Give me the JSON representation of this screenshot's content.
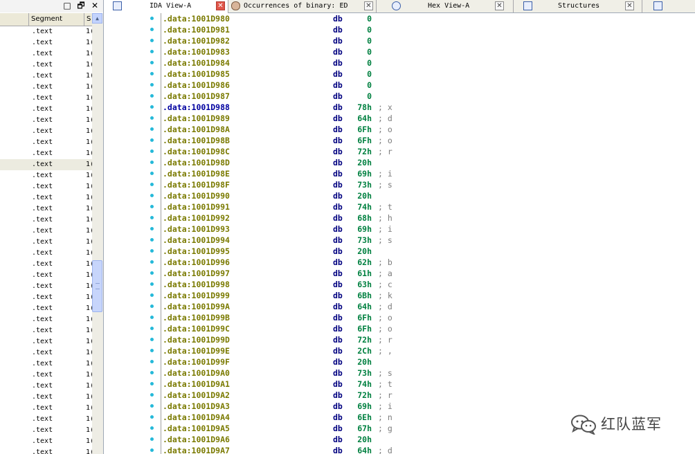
{
  "left_pane": {
    "header": {
      "segment": "Segment",
      "s": "S"
    },
    "title_buttons": [
      "□",
      "🗗",
      "✕"
    ],
    "rows": [
      {
        "segment": ".text",
        "s": "1("
      },
      {
        "segment": ".text",
        "s": "1("
      },
      {
        "segment": ".text",
        "s": "1("
      },
      {
        "segment": ".text",
        "s": "1("
      },
      {
        "segment": ".text",
        "s": "1("
      },
      {
        "segment": ".text",
        "s": "1("
      },
      {
        "segment": ".text",
        "s": "1("
      },
      {
        "segment": ".text",
        "s": "1("
      },
      {
        "segment": ".text",
        "s": "1("
      },
      {
        "segment": ".text",
        "s": "1("
      },
      {
        "segment": ".text",
        "s": "1("
      },
      {
        "segment": ".text",
        "s": "1("
      },
      {
        "segment": ".text",
        "s": "1("
      },
      {
        "segment": ".text",
        "s": "1("
      },
      {
        "segment": ".text",
        "s": "1("
      },
      {
        "segment": ".text",
        "s": "1("
      },
      {
        "segment": ".text",
        "s": "1("
      },
      {
        "segment": ".text",
        "s": "1("
      },
      {
        "segment": ".text",
        "s": "1("
      },
      {
        "segment": ".text",
        "s": "1("
      },
      {
        "segment": ".text",
        "s": "1("
      },
      {
        "segment": ".text",
        "s": "1("
      },
      {
        "segment": ".text",
        "s": "1("
      },
      {
        "segment": ".text",
        "s": "1("
      },
      {
        "segment": ".text",
        "s": "1("
      },
      {
        "segment": ".text",
        "s": "1("
      },
      {
        "segment": ".text",
        "s": "1("
      },
      {
        "segment": ".text",
        "s": "1("
      },
      {
        "segment": ".text",
        "s": "1("
      },
      {
        "segment": ".text",
        "s": "1("
      },
      {
        "segment": ".text",
        "s": "1("
      },
      {
        "segment": ".text",
        "s": "1("
      },
      {
        "segment": ".text",
        "s": "1("
      },
      {
        "segment": ".text",
        "s": "1("
      },
      {
        "segment": ".text",
        "s": "1("
      },
      {
        "segment": ".text",
        "s": "1("
      },
      {
        "segment": ".text",
        "s": "1("
      },
      {
        "segment": ".text",
        "s": "1("
      },
      {
        "segment": ".text",
        "s": "1("
      },
      {
        "segment": ".text",
        "s": "1("
      }
    ],
    "selected_row": 12
  },
  "tabs": [
    {
      "label": "IDA View-A",
      "close": "✕"
    },
    {
      "label": "Occurrences of binary: ED",
      "close": "✕"
    },
    {
      "label": "Hex View-A",
      "close": "✕"
    },
    {
      "label": "Structures",
      "close": "✕"
    }
  ],
  "disasm": {
    "rows": [
      {
        "addr": ".data:1001D980",
        "mn": "db",
        "val": "0",
        "cmt": ""
      },
      {
        "addr": ".data:1001D981",
        "mn": "db",
        "val": "0",
        "cmt": ""
      },
      {
        "addr": ".data:1001D982",
        "mn": "db",
        "val": "0",
        "cmt": ""
      },
      {
        "addr": ".data:1001D983",
        "mn": "db",
        "val": "0",
        "cmt": ""
      },
      {
        "addr": ".data:1001D984",
        "mn": "db",
        "val": "0",
        "cmt": ""
      },
      {
        "addr": ".data:1001D985",
        "mn": "db",
        "val": "0",
        "cmt": ""
      },
      {
        "addr": ".data:1001D986",
        "mn": "db",
        "val": "0",
        "cmt": ""
      },
      {
        "addr": ".data:1001D987",
        "mn": "db",
        "val": "0",
        "cmt": ""
      },
      {
        "addr": ".data:1001D988",
        "mn": "db",
        "val": "78h",
        "cmt": "; x",
        "highlight": true
      },
      {
        "addr": ".data:1001D989",
        "mn": "db",
        "val": "64h",
        "cmt": "; d"
      },
      {
        "addr": ".data:1001D98A",
        "mn": "db",
        "val": "6Fh",
        "cmt": "; o"
      },
      {
        "addr": ".data:1001D98B",
        "mn": "db",
        "val": "6Fh",
        "cmt": "; o"
      },
      {
        "addr": ".data:1001D98C",
        "mn": "db",
        "val": "72h",
        "cmt": "; r"
      },
      {
        "addr": ".data:1001D98D",
        "mn": "db",
        "val": "20h",
        "cmt": ""
      },
      {
        "addr": ".data:1001D98E",
        "mn": "db",
        "val": "69h",
        "cmt": "; i"
      },
      {
        "addr": ".data:1001D98F",
        "mn": "db",
        "val": "73h",
        "cmt": "; s"
      },
      {
        "addr": ".data:1001D990",
        "mn": "db",
        "val": "20h",
        "cmt": ""
      },
      {
        "addr": ".data:1001D991",
        "mn": "db",
        "val": "74h",
        "cmt": "; t"
      },
      {
        "addr": ".data:1001D992",
        "mn": "db",
        "val": "68h",
        "cmt": "; h"
      },
      {
        "addr": ".data:1001D993",
        "mn": "db",
        "val": "69h",
        "cmt": "; i"
      },
      {
        "addr": ".data:1001D994",
        "mn": "db",
        "val": "73h",
        "cmt": "; s"
      },
      {
        "addr": ".data:1001D995",
        "mn": "db",
        "val": "20h",
        "cmt": ""
      },
      {
        "addr": ".data:1001D996",
        "mn": "db",
        "val": "62h",
        "cmt": "; b"
      },
      {
        "addr": ".data:1001D997",
        "mn": "db",
        "val": "61h",
        "cmt": "; a"
      },
      {
        "addr": ".data:1001D998",
        "mn": "db",
        "val": "63h",
        "cmt": "; c"
      },
      {
        "addr": ".data:1001D999",
        "mn": "db",
        "val": "6Bh",
        "cmt": "; k"
      },
      {
        "addr": ".data:1001D99A",
        "mn": "db",
        "val": "64h",
        "cmt": "; d"
      },
      {
        "addr": ".data:1001D99B",
        "mn": "db",
        "val": "6Fh",
        "cmt": "; o"
      },
      {
        "addr": ".data:1001D99C",
        "mn": "db",
        "val": "6Fh",
        "cmt": "; o"
      },
      {
        "addr": ".data:1001D99D",
        "mn": "db",
        "val": "72h",
        "cmt": "; r"
      },
      {
        "addr": ".data:1001D99E",
        "mn": "db",
        "val": "2Ch",
        "cmt": "; ,"
      },
      {
        "addr": ".data:1001D99F",
        "mn": "db",
        "val": "20h",
        "cmt": ""
      },
      {
        "addr": ".data:1001D9A0",
        "mn": "db",
        "val": "73h",
        "cmt": "; s"
      },
      {
        "addr": ".data:1001D9A1",
        "mn": "db",
        "val": "74h",
        "cmt": "; t"
      },
      {
        "addr": ".data:1001D9A2",
        "mn": "db",
        "val": "72h",
        "cmt": "; r"
      },
      {
        "addr": ".data:1001D9A3",
        "mn": "db",
        "val": "69h",
        "cmt": "; i"
      },
      {
        "addr": ".data:1001D9A4",
        "mn": "db",
        "val": "6Eh",
        "cmt": "; n"
      },
      {
        "addr": ".data:1001D9A5",
        "mn": "db",
        "val": "67h",
        "cmt": "; g"
      },
      {
        "addr": ".data:1001D9A6",
        "mn": "db",
        "val": "20h",
        "cmt": ""
      },
      {
        "addr": ".data:1001D9A7",
        "mn": "db",
        "val": "64h",
        "cmt": "; d"
      }
    ]
  },
  "watermark": {
    "text": "红队蓝军"
  },
  "colors": {
    "address": "#7a7a00",
    "address_highlight": "#0000a0",
    "mnemonic": "#000080",
    "value": "#008040",
    "comment": "#7c7c7c",
    "dot": "#25b9d9"
  }
}
